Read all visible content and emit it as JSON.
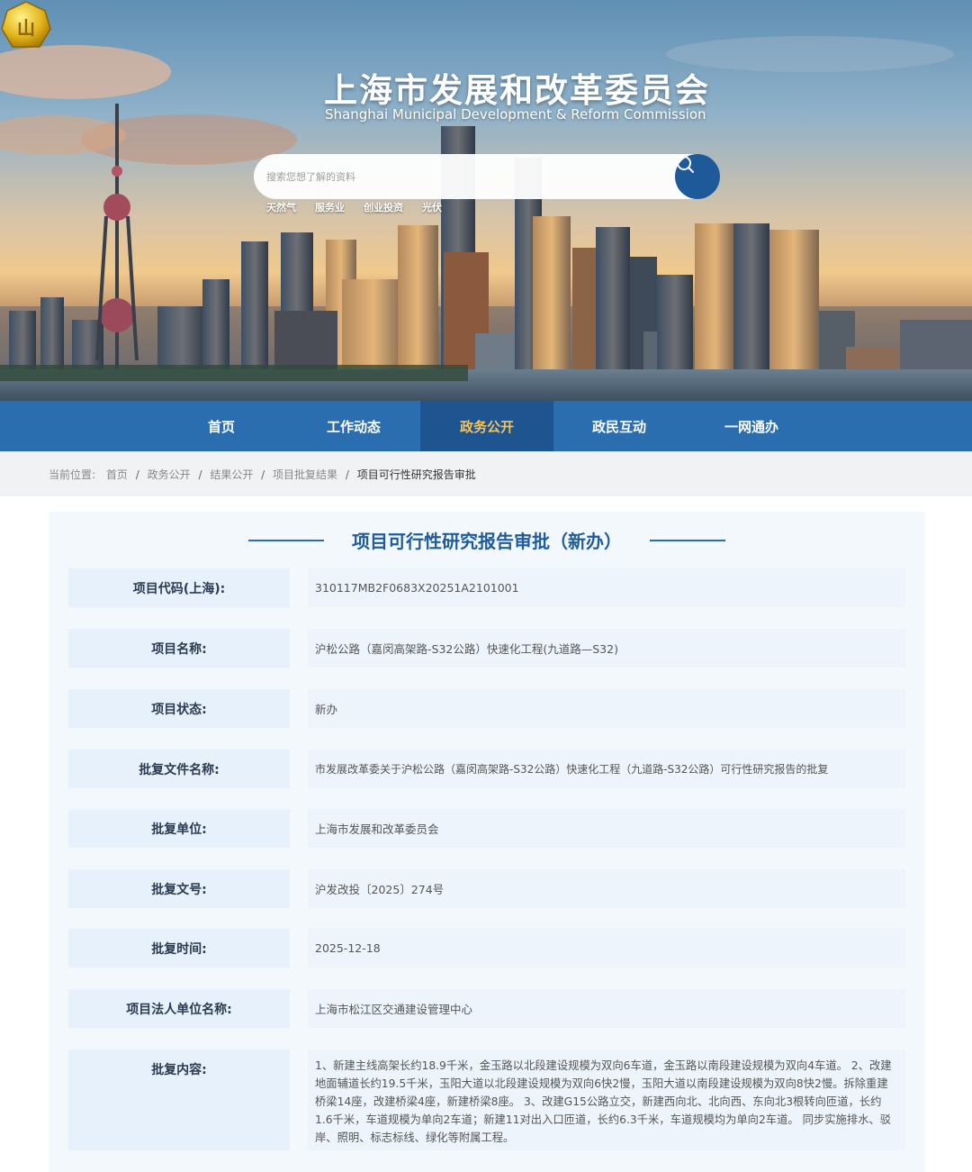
{
  "header": {
    "title": "上海市发展和改革委员会",
    "subtitle": "Shanghai Municipal Development & Reform Commission",
    "logo_text": "山"
  },
  "search": {
    "placeholder": "搜索您想了解的资料",
    "hot_words": [
      "天然气",
      "服务业",
      "创业投资",
      "光伏"
    ]
  },
  "nav": {
    "items": [
      "首页",
      "工作动态",
      "政务公开",
      "政民互动",
      "一网通办"
    ],
    "active_index": 2
  },
  "breadcrumb": {
    "prefix": "当前位置:",
    "items": [
      "首页",
      "政务公开",
      "结果公开",
      "项目批复结果"
    ],
    "current": "项目可行性研究报告审批"
  },
  "detail": {
    "title": "项目可行性研究报告审批（新办）",
    "rows": [
      {
        "label": "项目代码(上海):",
        "value": "310117MB2F0683X20251A2101001"
      },
      {
        "label": "项目名称:",
        "value": "沪松公路（嘉闵高架路-S32公路）快速化工程(九道路—S32)"
      },
      {
        "label": "项目状态:",
        "value": "新办"
      },
      {
        "label": "批复文件名称:",
        "value": "市发展改革委关于沪松公路（嘉闵高架路-S32公路）快速化工程（九道路-S32公路）可行性研究报告的批复"
      },
      {
        "label": "批复单位:",
        "value": "上海市发展和改革委员会"
      },
      {
        "label": "批复文号:",
        "value": "沪发改投〔2025〕274号"
      },
      {
        "label": "批复时间:",
        "value": "2025-12-18"
      },
      {
        "label": "项目法人单位名称:",
        "value": "上海市松江区交通建设管理中心"
      },
      {
        "label": "批复内容:",
        "value": "1、新建主线高架长约18.9千米，金玉路以北段建设规模为双向6车道，金玉路以南段建设规模为双向4车道。 2、改建地面辅道长约19.5千米，玉阳大道以北段建设规模为双向6快2慢，玉阳大道以南段建设规模为双向8快2慢。拆除重建桥梁14座，改建桥梁4座，新建桥梁8座。 3、改建G15公路立交，新建西向北、北向西、东向北3根转向匝道，长约1.6千米，车道规模为单向2车道；新建11对出入口匝道，长约6.3千米，车道规模均为单向2车道。 同步实施排水、驳岸、照明、标志标线、绿化等附属工程。"
      }
    ]
  }
}
